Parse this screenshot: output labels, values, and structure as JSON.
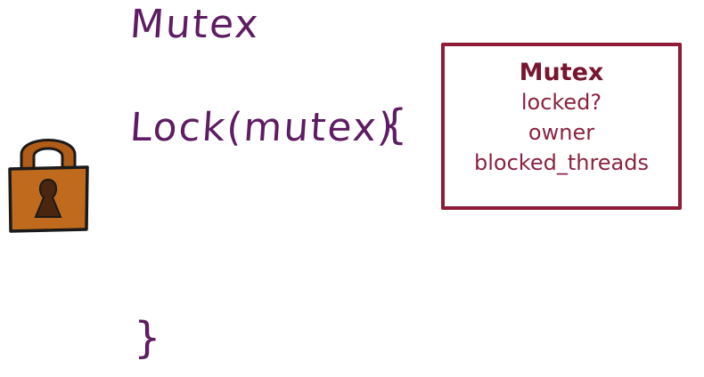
{
  "colors": {
    "handwriting": "#5e1d63",
    "box_border": "#8e1c38",
    "box_text": "#8a2340",
    "box_title": "#7a1530",
    "lock_body": "#c06a1d",
    "lock_shackle": "#b15c17",
    "lock_outline": "#1a1a1a",
    "keyhole": "#4a2510"
  },
  "handwritten": {
    "title": "Mutex",
    "lock_call": "Lock(mutex)",
    "open_brace": "{",
    "close_brace": "}"
  },
  "mutex_box": {
    "title": "Mutex",
    "fields": [
      "locked?",
      "owner",
      "blocked_threads"
    ]
  },
  "icons": {
    "padlock": "padlock-icon"
  }
}
